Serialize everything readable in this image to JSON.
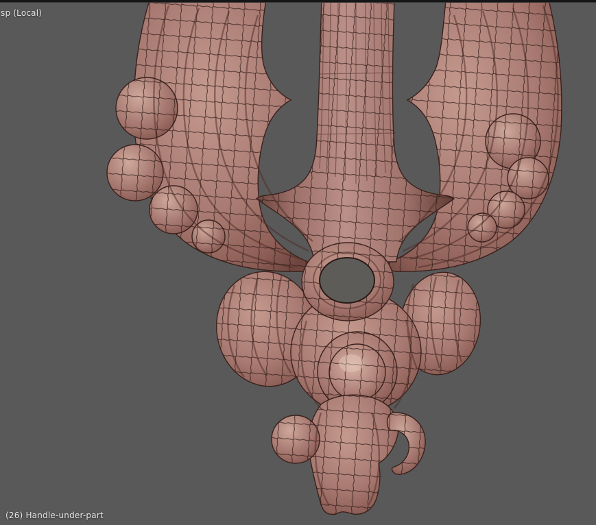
{
  "viewport": {
    "view_label": "sp (Local)",
    "object_info": "(26) Handle-under-part",
    "frame_number": "26",
    "object_name": "Handle-under-part"
  },
  "scene": {
    "background_color": "#595959",
    "top_edge_color": "#161616",
    "label_text_color": "#e7e7e5",
    "hole_color": "#5e5c58"
  },
  "mesh": {
    "name": "Handle-under-part",
    "display_mode": "solid-with-wireframe",
    "surface_color": "#a87a72",
    "highlight_color": "#c59a8e",
    "shadow_color": "#6e463f",
    "outline_color": "#3a211d",
    "wireframe_color": "#2f1b18",
    "parts": [
      "center-shaft",
      "left-scroll",
      "right-scroll",
      "left-knob-cluster",
      "right-knob-cluster",
      "center-ring",
      "ring-hole",
      "left-lobe",
      "right-lobe",
      "center-bulb",
      "dome-boss",
      "bottom-pendant"
    ]
  }
}
